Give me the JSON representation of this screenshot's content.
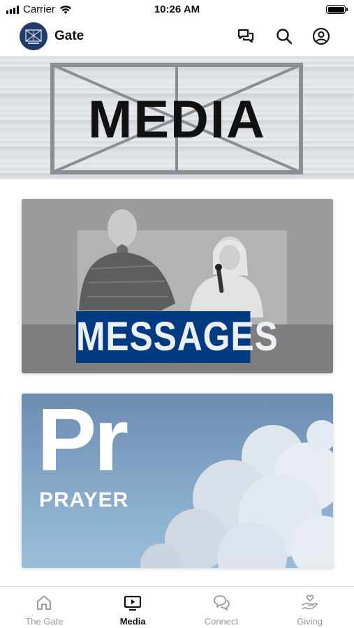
{
  "status_bar": {
    "carrier": "Carrier",
    "time": "10:26 AM"
  },
  "header": {
    "title": "Gate",
    "icons": [
      "chat-icon",
      "search-icon",
      "profile-icon"
    ]
  },
  "banner": {
    "title": "MEDIA"
  },
  "cards": [
    {
      "label": "MESSAGES",
      "label_bg": "#003a80"
    },
    {
      "big": "Pr",
      "label": "PRAYER"
    }
  ],
  "tabs": [
    {
      "label": "The Gate",
      "icon": "home-icon",
      "active": false
    },
    {
      "label": "Media",
      "icon": "tv-play-icon",
      "active": true
    },
    {
      "label": "Connect",
      "icon": "chat-bubbles-icon",
      "active": false
    },
    {
      "label": "Giving",
      "icon": "giving-hand-icon",
      "active": false
    }
  ],
  "colors": {
    "brand": "#1f3a6b",
    "messages_label": "#003a80",
    "inactive_tab": "#9a9a9a"
  }
}
